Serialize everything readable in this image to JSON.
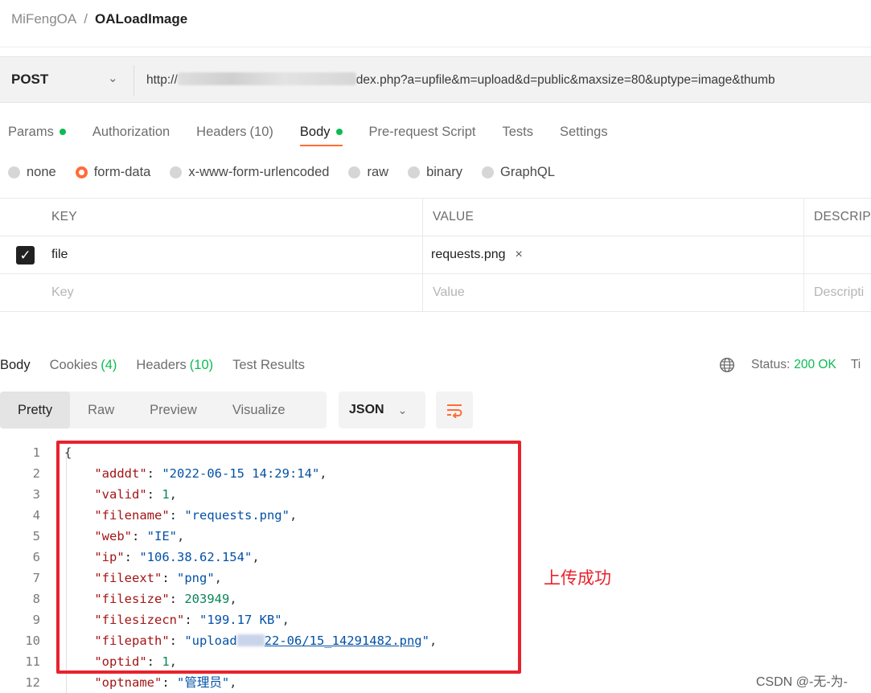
{
  "breadcrumb": {
    "workspace": "MiFengOA",
    "separator": "/",
    "request": "OALoadImage"
  },
  "request": {
    "method": "POST",
    "url_prefix": "http://",
    "url_suffix": "dex.php?a=upfile&m=upload&d=public&maxsize=80&uptype=image&thumb"
  },
  "tabs": [
    {
      "label": "Params",
      "dot": true
    },
    {
      "label": "Authorization"
    },
    {
      "label": "Headers",
      "count": "(10)"
    },
    {
      "label": "Body",
      "dot": true,
      "active": true
    },
    {
      "label": "Pre-request Script"
    },
    {
      "label": "Tests"
    },
    {
      "label": "Settings"
    }
  ],
  "body_types": [
    "none",
    "form-data",
    "x-www-form-urlencoded",
    "raw",
    "binary",
    "GraphQL"
  ],
  "body_type_selected": "form-data",
  "form_table": {
    "headers": {
      "key": "KEY",
      "value": "VALUE",
      "description": "DESCRIP"
    },
    "rows": [
      {
        "checked": true,
        "key": "file",
        "value": "requests.png",
        "remove": "×"
      }
    ],
    "placeholders": {
      "key": "Key",
      "value": "Value",
      "description": "Descripti"
    }
  },
  "response_tabs": [
    {
      "label": "Body",
      "active": true
    },
    {
      "label": "Cookies",
      "count": "(4)"
    },
    {
      "label": "Headers",
      "count": "(10)"
    },
    {
      "label": "Test Results"
    }
  ],
  "status": {
    "label": "Status:",
    "value": "200 OK",
    "trail": "Ti"
  },
  "format_buttons": [
    "Pretty",
    "Raw",
    "Preview",
    "Visualize"
  ],
  "format_selected": "Pretty",
  "language": "JSON",
  "code_lines": [
    {
      "n": "1",
      "t": "{"
    },
    {
      "n": "2",
      "k": "\"adddt\"",
      "v": "\"2022-06-15 14:29:14\"",
      "vt": "s",
      "tail": ","
    },
    {
      "n": "3",
      "k": "\"valid\"",
      "v": "1",
      "vt": "n",
      "tail": ","
    },
    {
      "n": "4",
      "k": "\"filename\"",
      "v": "\"requests.png\"",
      "vt": "s",
      "tail": ","
    },
    {
      "n": "5",
      "k": "\"web\"",
      "v": "\"IE\"",
      "vt": "s",
      "tail": ","
    },
    {
      "n": "6",
      "k": "\"ip\"",
      "v": "\"106.38.62.154\"",
      "vt": "s",
      "tail": ","
    },
    {
      "n": "7",
      "k": "\"fileext\"",
      "v": "\"png\"",
      "vt": "s",
      "tail": ","
    },
    {
      "n": "8",
      "k": "\"filesize\"",
      "v": "203949",
      "vt": "n",
      "tail": ","
    },
    {
      "n": "9",
      "k": "\"filesizecn\"",
      "v": "\"199.17 KB\"",
      "vt": "s",
      "tail": ","
    },
    {
      "n": "10",
      "k": "\"filepath\"",
      "v1": "\"upload",
      "v2": "22-06/15_14291482.png",
      "v3": "\"",
      "vt": "link",
      "tail": ","
    },
    {
      "n": "11",
      "k": "\"optid\"",
      "v": "1",
      "vt": "n",
      "tail": ","
    },
    {
      "n": "12",
      "k": "\"optname\"",
      "v": "\"管理员\"",
      "vt": "s",
      "tail": ","
    }
  ],
  "annotation": "上传成功",
  "watermark": "CSDN @-无-为-"
}
